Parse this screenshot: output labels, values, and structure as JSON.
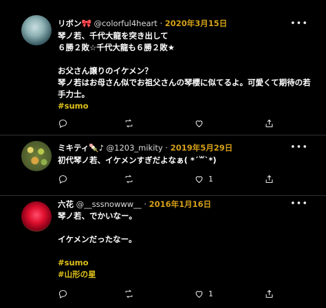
{
  "tweets": [
    {
      "name": "リボン",
      "emoji": "🎀",
      "handle": "@colorful4heart",
      "separator": "·",
      "date": "2020年3月15日",
      "body": "琴ノ若、千代大龍を突き出して\n６勝２敗☆千代大龍も６勝２敗★\n\nお父さん譲りのイケメン？\n琴ノ若はお母さん似でお祖父さんの琴櫻に似てるよ。可愛くて期待の若手力士。",
      "hashtags": [
        "#sumo"
      ],
      "reply_count": "",
      "retweet_count": "",
      "like_count": ""
    },
    {
      "name": "ミキティ",
      "emoji": "🍡♪",
      "handle": "@1203_mikity",
      "separator": "·",
      "date": "2019年5月29日",
      "body": "初代琴ノ若、イケメンすぎだよなぁ( *´꒳`*)",
      "hashtags": [],
      "reply_count": "",
      "retweet_count": "",
      "like_count": "1"
    },
    {
      "name": "六花",
      "emoji": "",
      "handle": "@__sssnowww__",
      "separator": "·",
      "date": "2016年1月16日",
      "body": "琴ノ若、でかいなー。\n\nイケメンだったなー。",
      "hashtags": [
        "#sumo",
        "#山形の星"
      ],
      "reply_count": "",
      "retweet_count": "",
      "like_count": "1"
    }
  ],
  "colors": {
    "background": "#000000",
    "divider": "#2f3336",
    "date": "#d4a017",
    "hashtag": "#e0c21b"
  },
  "icons": [
    "more-icon",
    "reply-icon",
    "retweet-icon",
    "like-icon",
    "share-icon"
  ]
}
